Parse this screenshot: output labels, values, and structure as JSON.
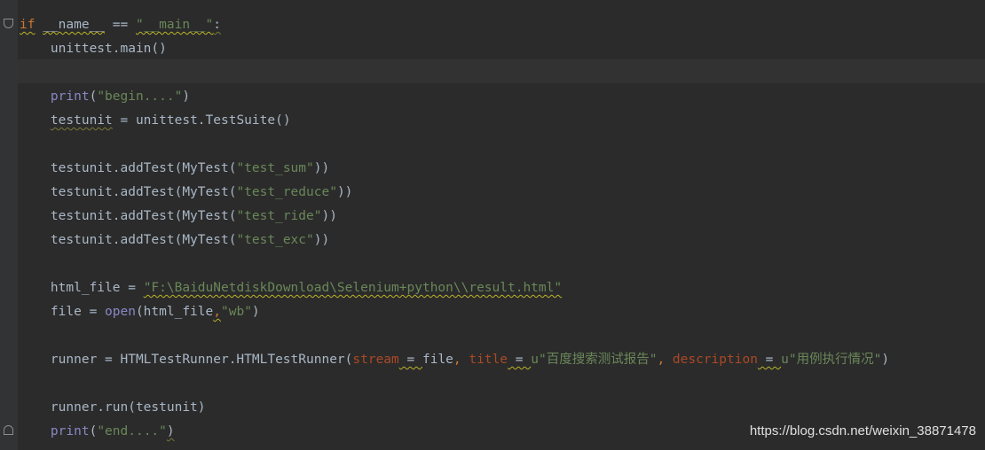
{
  "editor": {
    "lines": [
      {
        "segments": [
          {
            "text": "if",
            "cls": "kw warn"
          },
          {
            "text": " ",
            "cls": ""
          },
          {
            "text": "__name__",
            "cls": "warn"
          },
          {
            "text": " == ",
            "cls": ""
          },
          {
            "text": "\"__main__\"",
            "cls": "str warn"
          },
          {
            "text": ":",
            "cls": "weak"
          }
        ]
      },
      {
        "segments": [
          {
            "text": "    unittest.main()",
            "cls": ""
          }
        ]
      },
      {
        "segments": []
      },
      {
        "segments": [
          {
            "text": "    ",
            "cls": ""
          },
          {
            "text": "print",
            "cls": "bi"
          },
          {
            "text": "(",
            "cls": ""
          },
          {
            "text": "\"begin....\"",
            "cls": "str"
          },
          {
            "text": ")",
            "cls": ""
          }
        ]
      },
      {
        "segments": [
          {
            "text": "    ",
            "cls": ""
          },
          {
            "text": "testunit",
            "cls": "weak"
          },
          {
            "text": " = unittest.TestSuite()",
            "cls": ""
          }
        ]
      },
      {
        "segments": []
      },
      {
        "segments": [
          {
            "text": "    testunit.addTest(MyTest(",
            "cls": ""
          },
          {
            "text": "\"test_sum\"",
            "cls": "str"
          },
          {
            "text": "))",
            "cls": ""
          }
        ]
      },
      {
        "segments": [
          {
            "text": "    testunit.addTest(MyTest(",
            "cls": ""
          },
          {
            "text": "\"test_reduce\"",
            "cls": "str"
          },
          {
            "text": "))",
            "cls": ""
          }
        ]
      },
      {
        "segments": [
          {
            "text": "    testunit.addTest(MyTest(",
            "cls": ""
          },
          {
            "text": "\"test_ride\"",
            "cls": "str"
          },
          {
            "text": "))",
            "cls": ""
          }
        ]
      },
      {
        "segments": [
          {
            "text": "    testunit.addTest(MyTest(",
            "cls": ""
          },
          {
            "text": "\"test_exc\"",
            "cls": "str"
          },
          {
            "text": "))",
            "cls": ""
          }
        ]
      },
      {
        "segments": []
      },
      {
        "segments": [
          {
            "text": "    html_file = ",
            "cls": ""
          },
          {
            "text": "\"F:\\BaiduNetdiskDownload\\Selenium+python\\\\result.html\"",
            "cls": "str warn"
          }
        ]
      },
      {
        "segments": [
          {
            "text": "    file = ",
            "cls": ""
          },
          {
            "text": "open",
            "cls": "bi"
          },
          {
            "text": "(html_file",
            "cls": ""
          },
          {
            "text": ",",
            "cls": "kw warn"
          },
          {
            "text": "\"wb\"",
            "cls": "str"
          },
          {
            "text": ")",
            "cls": ""
          }
        ]
      },
      {
        "segments": []
      },
      {
        "segments": [
          {
            "text": "    runner = HTMLTestRunner.HTMLTestRunner(",
            "cls": ""
          },
          {
            "text": "stream",
            "cls": "param"
          },
          {
            "text": " = ",
            "cls": "warn"
          },
          {
            "text": "file",
            "cls": ""
          },
          {
            "text": ", ",
            "cls": "kw"
          },
          {
            "text": "title",
            "cls": "param"
          },
          {
            "text": " = ",
            "cls": "warn"
          },
          {
            "text": "u\"百度搜索测试报告\"",
            "cls": "str"
          },
          {
            "text": ", ",
            "cls": "kw"
          },
          {
            "text": "description",
            "cls": "param"
          },
          {
            "text": " = ",
            "cls": "warn"
          },
          {
            "text": "u\"用例执行情况\"",
            "cls": "str"
          },
          {
            "text": ")",
            "cls": ""
          }
        ]
      },
      {
        "segments": []
      },
      {
        "segments": [
          {
            "text": "    runner.run(testunit)",
            "cls": ""
          }
        ]
      },
      {
        "segments": [
          {
            "text": "    ",
            "cls": ""
          },
          {
            "text": "print",
            "cls": "bi"
          },
          {
            "text": "(",
            "cls": ""
          },
          {
            "text": "\"end....\"",
            "cls": "str"
          },
          {
            "text": ")",
            "cls": "weak"
          }
        ]
      }
    ]
  },
  "watermark": "https://blog.csdn.net/weixin_38871478",
  "colors": {
    "background": "#2b2b2b",
    "gutter": "#313335",
    "caret_line": "#323232",
    "default_text": "#a9b7c6",
    "keyword": "#cc7832",
    "builtin": "#8888c6",
    "string": "#6a8759",
    "parameter": "#aa4926"
  },
  "icons": [
    "fold-start-icon",
    "fold-end-icon"
  ]
}
